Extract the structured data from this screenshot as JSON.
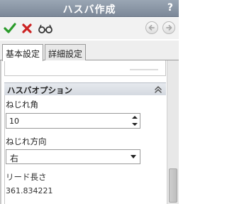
{
  "window": {
    "title": "ハスバ作成",
    "help": "?"
  },
  "toolbar": {
    "ok_icon": "check-icon",
    "cancel_icon": "x-icon",
    "preview_icon": "glasses-icon",
    "back_icon": "arrow-left-icon",
    "forward_icon": "arrow-right-icon",
    "colors": {
      "ok": "#2a9b2a",
      "cancel": "#cc2222"
    }
  },
  "tabs": [
    {
      "label": "基本設定",
      "active": true
    },
    {
      "label": "詳細設定",
      "active": false
    }
  ],
  "section": {
    "title": "ハスバオプション",
    "twist_angle": {
      "label": "ねじれ角",
      "value": "10"
    },
    "twist_direction": {
      "label": "ねじれ方向",
      "value": "右"
    },
    "lead_length": {
      "label": "リード長さ",
      "value": "361.834221"
    }
  }
}
